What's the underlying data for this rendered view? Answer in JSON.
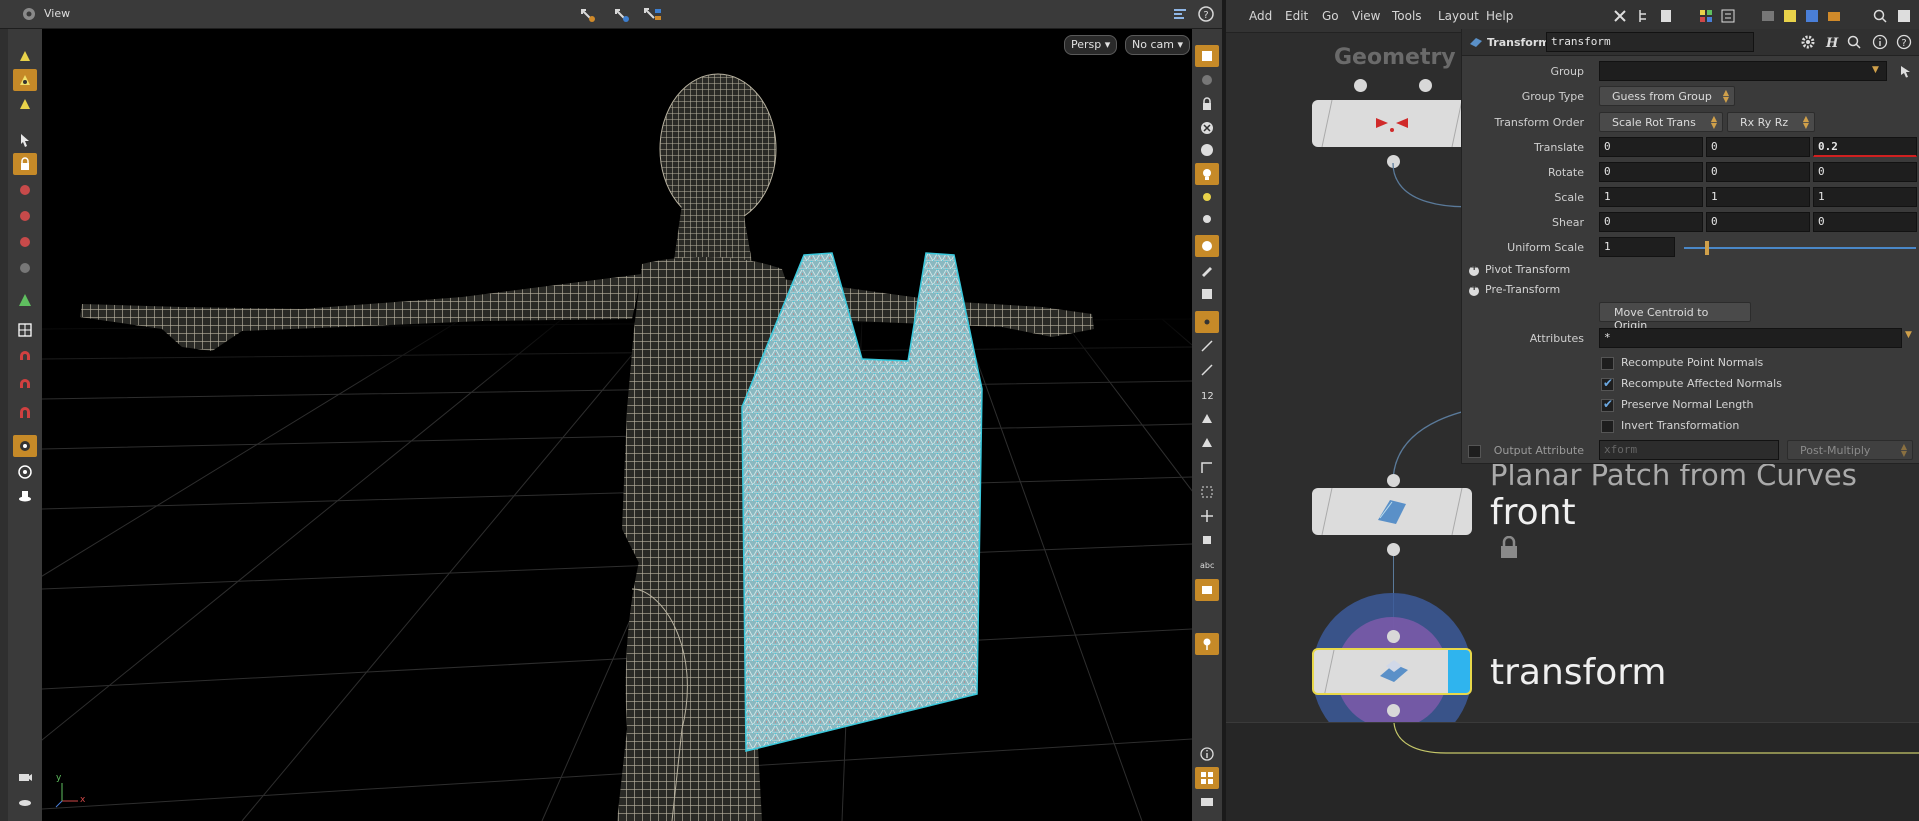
{
  "viewport": {
    "title": "View",
    "camera_mode": "Persp",
    "camera_select": "No cam",
    "axis": {
      "x": "x",
      "y": "y"
    }
  },
  "menubar": {
    "items": [
      "Add",
      "Edit",
      "Go",
      "View",
      "Tools",
      "Layout",
      "Help"
    ]
  },
  "params": {
    "node_type": "Transform",
    "node_name": "transform",
    "group_label": "Group",
    "group_value": "",
    "group_type_label": "Group Type",
    "group_type_value": "Guess from Group",
    "transform_order_label": "Transform Order",
    "transform_order_value": "Scale Rot Trans",
    "rotate_order_value": "Rx Ry Rz",
    "translate_label": "Translate",
    "translate": [
      "0",
      "0",
      "0.2"
    ],
    "rotate_label": "Rotate",
    "rotate": [
      "0",
      "0",
      "0"
    ],
    "scale_label": "Scale",
    "scale": [
      "1",
      "1",
      "1"
    ],
    "shear_label": "Shear",
    "shear": [
      "0",
      "0",
      "0"
    ],
    "uniform_scale_label": "Uniform Scale",
    "uniform_scale": "1",
    "uniform_scale_fraction": 0.1,
    "pivot_transform_label": "Pivot Transform",
    "pre_transform_label": "Pre-Transform",
    "move_centroid_label": "Move Centroid to Origin",
    "attributes_label": "Attributes",
    "attributes_value": "*",
    "checkboxes": [
      {
        "label": "Recompute Point Normals",
        "checked": false
      },
      {
        "label": "Recompute Affected Normals",
        "checked": true
      },
      {
        "label": "Preserve Normal Length",
        "checked": true
      },
      {
        "label": "Invert Transformation",
        "checked": false
      }
    ],
    "output_attribute_label": "Output Attribute",
    "output_attribute_placeholder": "xform",
    "output_mode_value": "Post-Multiply"
  },
  "network": {
    "context_label": "Geometry",
    "nodes": [
      {
        "name": "front",
        "type_label": "Planar Patch from Curves"
      },
      {
        "name": "transform",
        "type_label": ""
      }
    ]
  },
  "colors": {
    "accent_orange": "#c68a28",
    "selected_node_outline": "#e8d84a",
    "display_flag_blue": "#2fb4ee",
    "mesh_color": "#b8b2a0",
    "cloth_color": "#9bd6dc"
  }
}
